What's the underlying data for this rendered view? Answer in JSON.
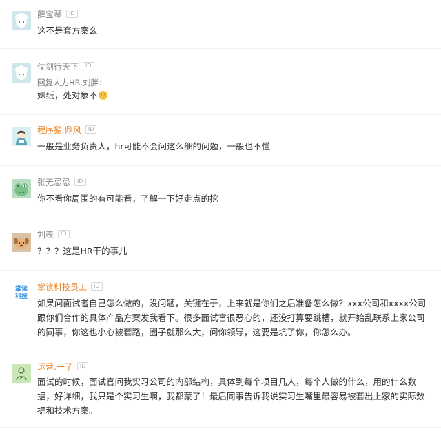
{
  "id_badge": "ID",
  "comments": [
    {
      "user": "薛宝琴",
      "text": "这不是套方案么",
      "avatar_icon": "sheep-avatar"
    },
    {
      "user": "仗剑行天下",
      "reply": "回复人力HR.刘胖：",
      "text": "妹纸，处对象不",
      "avatar_icon": "sheep-avatar"
    },
    {
      "user": "程序猿.鼎风",
      "text": "一般是业务负责人，hr可能不会问这么细的问题，一般也不懂",
      "avatar_icon": "girl-avatar"
    },
    {
      "user": "张无忌忌",
      "text": "你不看你周围的有可能看，了解一下好走点的挖",
      "avatar_icon": "frog-avatar"
    },
    {
      "user": "刘表",
      "text": "？？？这是HR干的事儿",
      "avatar_icon": "dog-avatar"
    },
    {
      "user": "掌读科技员工",
      "avatar_text": "掌读\n科技",
      "text": "如果问面试者自己怎么做的，没问题，关键在于，上来就是你们之后准备怎么做？xxx公司和xxxx公司跟你们合作的具体产品方案发我看下。很多面试官很恶心的，还没打算要跳槽，就开始乱联系上家公司的同事，你这也小心被套路，圈子就那么大，问你领导，这要是坑了你，你怎么办。"
    },
    {
      "user": "运营.一了",
      "text": "面试的时候，面试官问我实习公司的内部结构，具体到每个项目几人，每个人做的什么，用的什么数据，好详细，我只是个实习生啊，我都蒙了！最后同事告诉我说实习生嘴里最容易被套出上家的实际数据和技术方案。",
      "avatar_icon": "person-avatar"
    }
  ]
}
